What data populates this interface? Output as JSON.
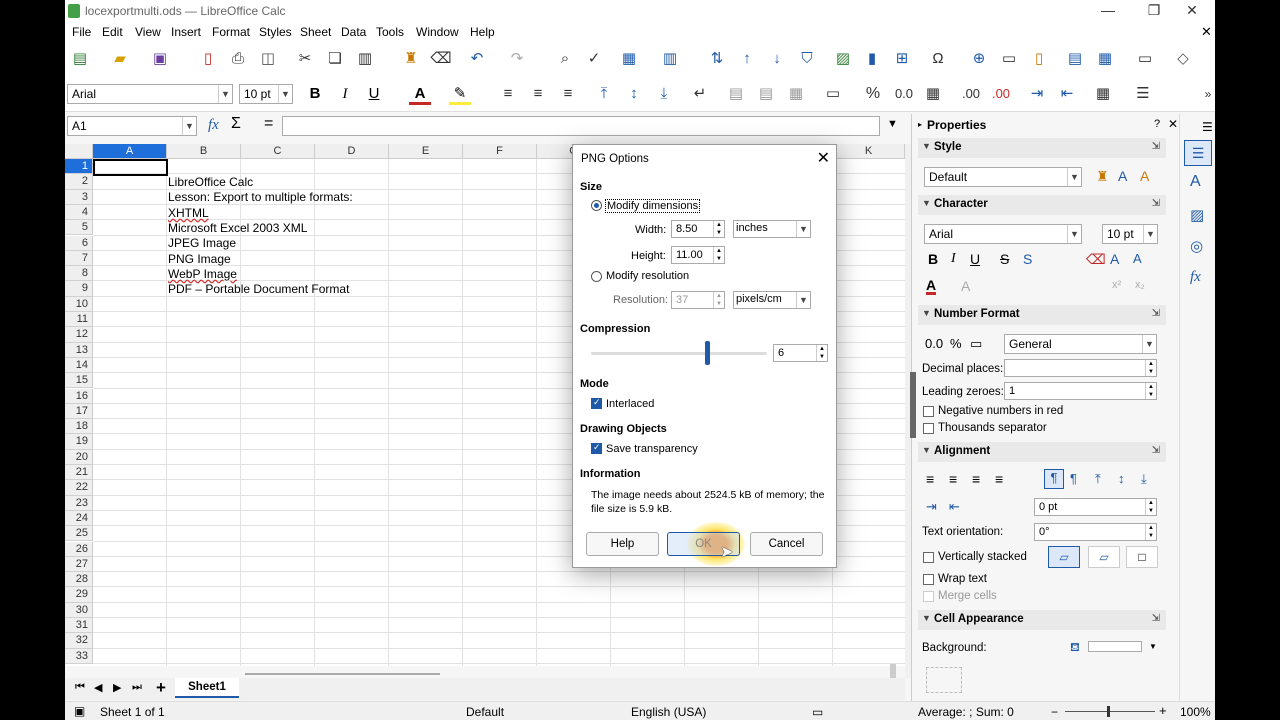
{
  "window": {
    "title": "locexportmulti.ods — LibreOffice Calc"
  },
  "menu": [
    "File",
    "Edit",
    "View",
    "Insert",
    "Format",
    "Styles",
    "Sheet",
    "Data",
    "Tools",
    "Window",
    "Help"
  ],
  "toolbar": {
    "font_name": "Arial",
    "font_size": "10 pt",
    "bold": "B",
    "italic": "I",
    "underline": "U",
    "percent": "%",
    "number_format": "0.0",
    "decimal_add": ".00",
    "decimal_remove": ".00"
  },
  "formula_bar": {
    "name_box": "A1",
    "fx": "fx",
    "sum": "Σ",
    "equals": "="
  },
  "grid": {
    "columns": [
      "A",
      "B",
      "C",
      "D",
      "E",
      "F",
      "G",
      "H",
      "I",
      "J",
      "K"
    ],
    "rows": [
      "1",
      "2",
      "3",
      "4",
      "5",
      "6",
      "7",
      "8",
      "9",
      "10",
      "11",
      "12",
      "13",
      "14",
      "15",
      "16",
      "17",
      "18",
      "19",
      "20",
      "21",
      "22",
      "23",
      "24",
      "25",
      "26",
      "27",
      "28",
      "29",
      "30",
      "31",
      "32",
      "33"
    ],
    "cells_b": [
      "LibreOffice Calc",
      "Lesson: Export to multiple formats:",
      "XHTML",
      "Microsoft Excel 2003 XML",
      "JPEG Image",
      "PNG Image",
      "WebP Image",
      "PDF – Portable Document Format"
    ]
  },
  "sheet_tab": "Sheet1",
  "status": {
    "sheet": "Sheet 1 of 1",
    "style": "Default",
    "language": "English (USA)",
    "summary": "Average: ; Sum: 0",
    "zoom": "100%"
  },
  "sidebar": {
    "title": "Properties",
    "help": "?",
    "style_section": "Style",
    "style_value": "Default",
    "character_section": "Character",
    "char_font": "Arial",
    "char_size": "10 pt",
    "number_section": "Number Format",
    "number_value": "General",
    "decimal_places_label": "Decimal places:",
    "leading_zeroes_label": "Leading zeroes:",
    "leading_zeroes_value": "1",
    "negative_red": "Negative numbers in red",
    "thousands_sep": "Thousands separator",
    "alignment_section": "Alignment",
    "indent_value": "0 pt",
    "text_orientation_label": "Text orientation:",
    "text_orientation_value": "0°",
    "vertically_stacked": "Vertically stacked",
    "wrap_text": "Wrap text",
    "merge_cells": "Merge cells",
    "cell_appearance_section": "Cell Appearance",
    "background_label": "Background:"
  },
  "dialog": {
    "title": "PNG Options",
    "size_section": "Size",
    "modify_dimensions": "Modify dimensions",
    "width_label": "Width:",
    "width_value": "8.50",
    "height_label": "Height:",
    "height_value": "11.00",
    "unit_value": "inches",
    "modify_resolution": "Modify resolution",
    "resolution_label": "Resolution:",
    "resolution_value": "37",
    "resolution_unit": "pixels/cm",
    "compression_section": "Compression",
    "compression_value": "6",
    "compression_fraction": 0.66,
    "mode_section": "Mode",
    "interlaced": "Interlaced",
    "drawing_section": "Drawing Objects",
    "save_transparency": "Save transparency",
    "info_section": "Information",
    "info_text": "The image needs about 2524.5 kB of memory; the file size is 5.9 kB.",
    "help_btn": "Help",
    "ok_btn": "OK",
    "cancel_btn": "Cancel"
  },
  "colors": {
    "accent": "#1e5aa8",
    "selection_header": "#1e6fd9",
    "cursor_highlight": "#f5a623"
  }
}
